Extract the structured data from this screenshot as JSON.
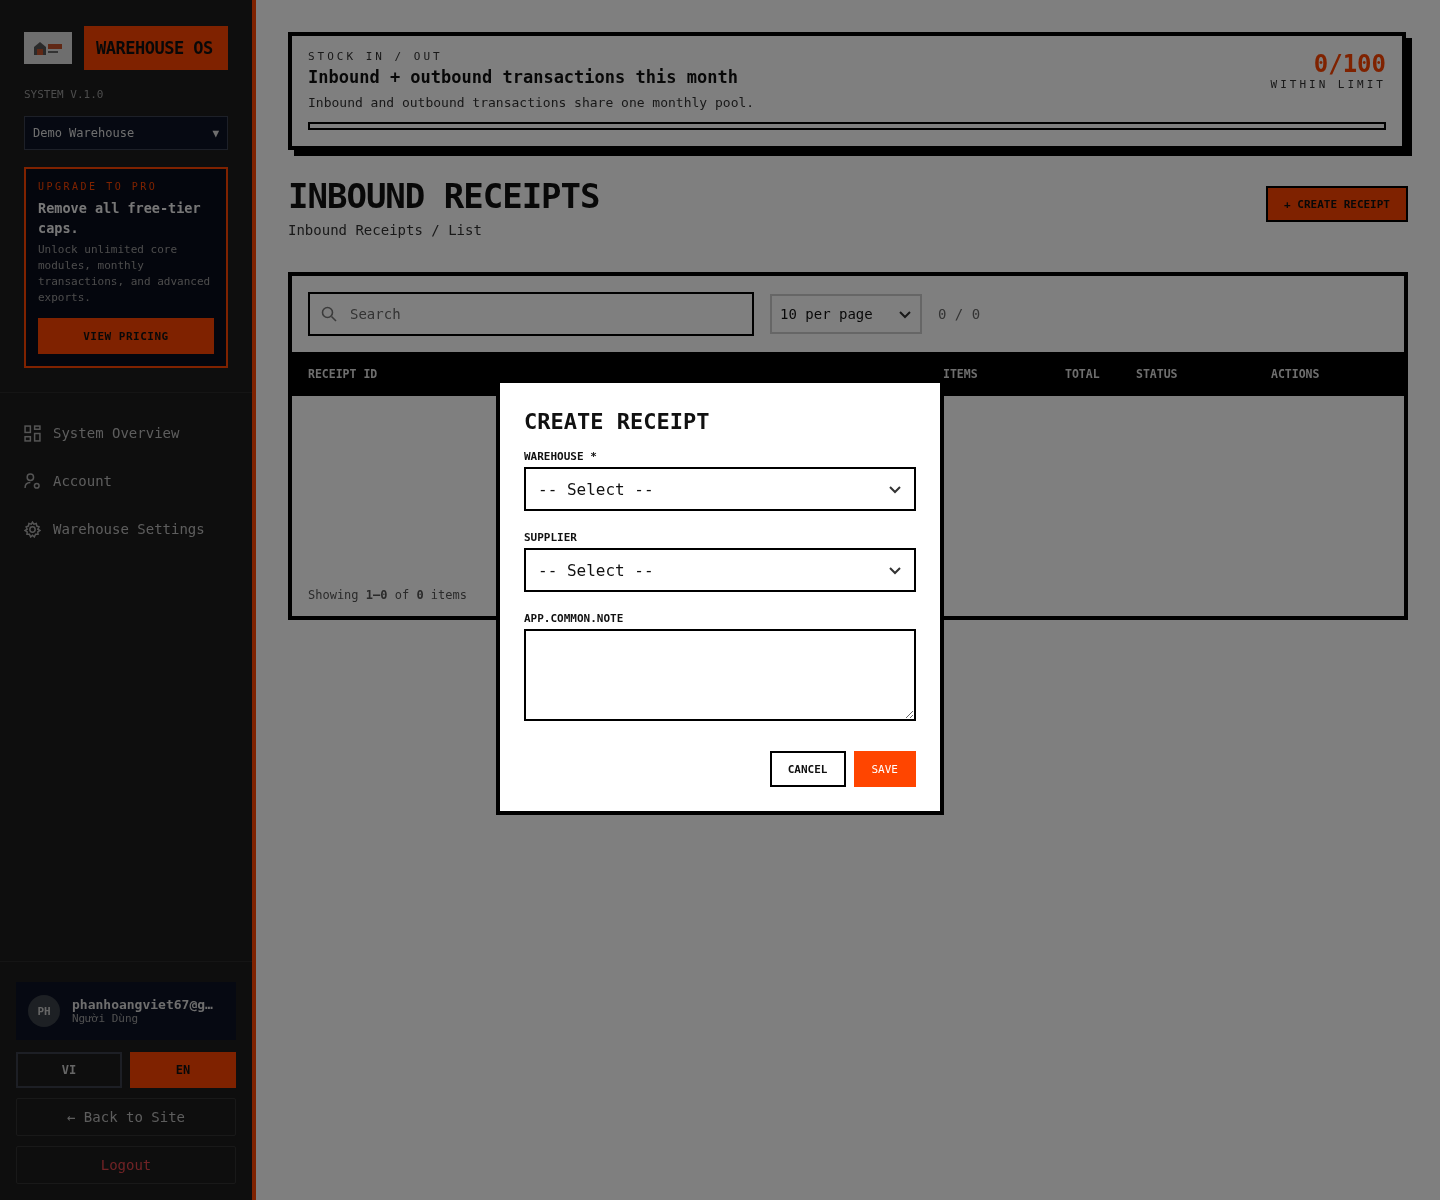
{
  "sidebar": {
    "brand": "WAREHOUSE OS",
    "version": "SYSTEM V.1.0",
    "warehouse_select": {
      "value": "Demo Warehouse",
      "caret": "▼"
    },
    "upgrade": {
      "eyebrow": "UPGRADE TO PRO",
      "title": "Remove all free-tier caps.",
      "body": "Unlock unlimited core modules, monthly transactions, and advanced exports.",
      "button": "VIEW PRICING"
    },
    "nav": [
      {
        "label": "System Overview",
        "kind": "grid",
        "selected": false
      },
      {
        "label": "Account",
        "kind": "user-gear",
        "selected": false
      },
      {
        "label": "Warehouse Settings",
        "kind": "gear",
        "selected": false
      }
    ],
    "user": {
      "initials": "PH",
      "email": "phanhoangviet67@g…",
      "role": "Người Dùng"
    },
    "languages": [
      {
        "label": "VI",
        "selected": false
      },
      {
        "label": "EN",
        "selected": true
      }
    ],
    "back_link": "← Back to Site",
    "logout": "Logout"
  },
  "quota": {
    "eyebrow": "STOCK IN / OUT",
    "title": "Inbound + outbound transactions this month",
    "description": "Inbound and outbound transactions share one monthly pool.",
    "count": "0/100",
    "status": "WITHIN LIMIT",
    "level": 0
  },
  "page": {
    "title": "INBOUND RECEIPTS",
    "breadcrumb": "Inbound Receipts / List",
    "create_button": "+ CREATE RECEIPT"
  },
  "table": {
    "search": {
      "placeholder": "Search"
    },
    "page_size": "10 per page",
    "pager": "0 / 0",
    "columns": [
      "RECEIPT ID",
      "ITEMS",
      "TOTAL",
      "STATUS",
      "ACTIONS"
    ],
    "footer": "Showing **1–0** of **0** items"
  },
  "modal": {
    "title": "CREATE RECEIPT",
    "fields": [
      {
        "label": "WAREHOUSE *",
        "kind": "select",
        "value": "-- Select --"
      },
      {
        "label": "SUPPLIER",
        "kind": "select",
        "value": "-- Select --"
      },
      {
        "label": "APP.COMMON.NOTE",
        "kind": "textarea"
      }
    ],
    "buttons": [
      {
        "label": "CANCEL",
        "kind": "secondary"
      },
      {
        "label": "SAVE",
        "kind": "primary"
      }
    ]
  }
}
